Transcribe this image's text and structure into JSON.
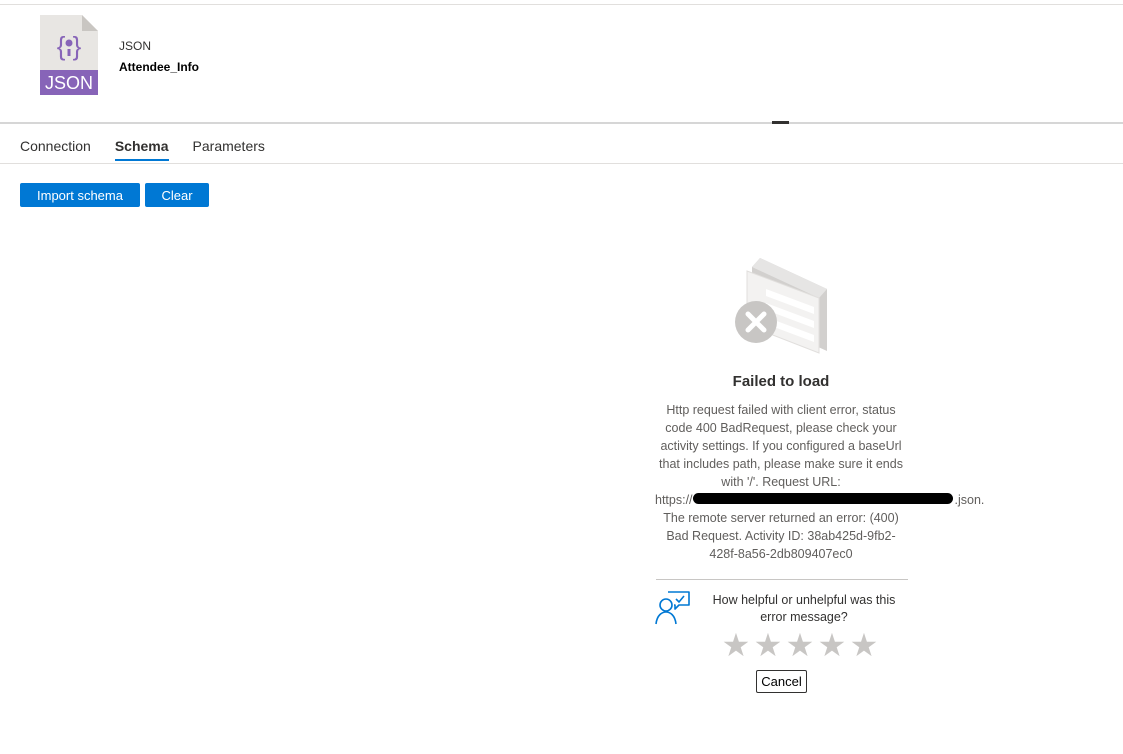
{
  "dataset": {
    "icon_label": "JSON",
    "type_label": "JSON",
    "name": "Attendee_Info",
    "icon_color": "#8764b8"
  },
  "tabs": [
    {
      "label": "Connection",
      "active": false
    },
    {
      "label": "Schema",
      "active": true
    },
    {
      "label": "Parameters",
      "active": false
    }
  ],
  "toolbar": {
    "import_label": "Import schema",
    "clear_label": "Clear"
  },
  "error": {
    "title": "Failed to load",
    "message_lines": [
      "Http request failed with client error, status",
      "code 400 BadRequest, please check your",
      "activity settings. If you configured a baseUrl",
      "that includes path, please make sure it ends",
      "with '/'. Request URL:",
      "https://",
      ".json.",
      "The remote server returned an error: (400)",
      "Bad Request. Activity ID: 38ab425d-9fb2-",
      "428f-8a56-2db809407ec0"
    ]
  },
  "feedback": {
    "question": "How helpful or unhelpful was this error message?",
    "stars": [
      "★",
      "★",
      "★",
      "★",
      "★"
    ],
    "cancel_label": "Cancel"
  },
  "colors": {
    "accent": "#0078d4",
    "star": "#c8c6c4"
  }
}
